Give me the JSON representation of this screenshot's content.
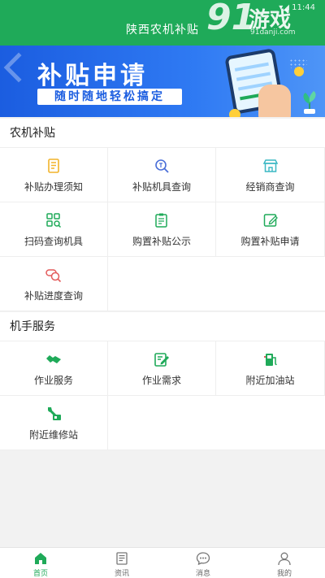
{
  "header": {
    "title": "陕西农机补贴",
    "status": "▾◢ 11:44"
  },
  "watermark": {
    "number": "91",
    "brand": "游戏",
    "url": "91danji.com"
  },
  "banner": {
    "title": "补贴申请",
    "subtitle": "随时随地轻松搞定"
  },
  "sections": [
    {
      "title": "农机补贴",
      "items": [
        {
          "label": "补贴办理须知",
          "icon": "notice-document-icon"
        },
        {
          "label": "补贴机具查询",
          "icon": "subsidy-search-icon"
        },
        {
          "label": "经销商查询",
          "icon": "store-icon"
        },
        {
          "label": "扫码查询机具",
          "icon": "scan-grid-icon"
        },
        {
          "label": "购置补贴公示",
          "icon": "clipboard-icon"
        },
        {
          "label": "购置补贴申请",
          "icon": "edit-icon"
        },
        {
          "label": "补贴进度查询",
          "icon": "progress-search-icon"
        }
      ]
    },
    {
      "title": "机手服务",
      "items": [
        {
          "label": "作业服务",
          "icon": "handshake-icon"
        },
        {
          "label": "作业需求",
          "icon": "demand-edit-icon"
        },
        {
          "label": "附近加油站",
          "icon": "fuel-pump-icon"
        },
        {
          "label": "附近维修站",
          "icon": "wrench-repair-icon"
        }
      ]
    }
  ],
  "tabbar": {
    "items": [
      {
        "label": "首页",
        "icon": "home-icon",
        "active": true
      },
      {
        "label": "资讯",
        "icon": "news-icon",
        "active": false
      },
      {
        "label": "消息",
        "icon": "message-icon",
        "active": false
      },
      {
        "label": "我的",
        "icon": "profile-icon",
        "active": false
      }
    ]
  },
  "colors": {
    "primary": "#1faa59",
    "banner_blue": "#1b5de0",
    "accent_yellow": "#f2b42a",
    "accent_red": "#e35b5b"
  }
}
